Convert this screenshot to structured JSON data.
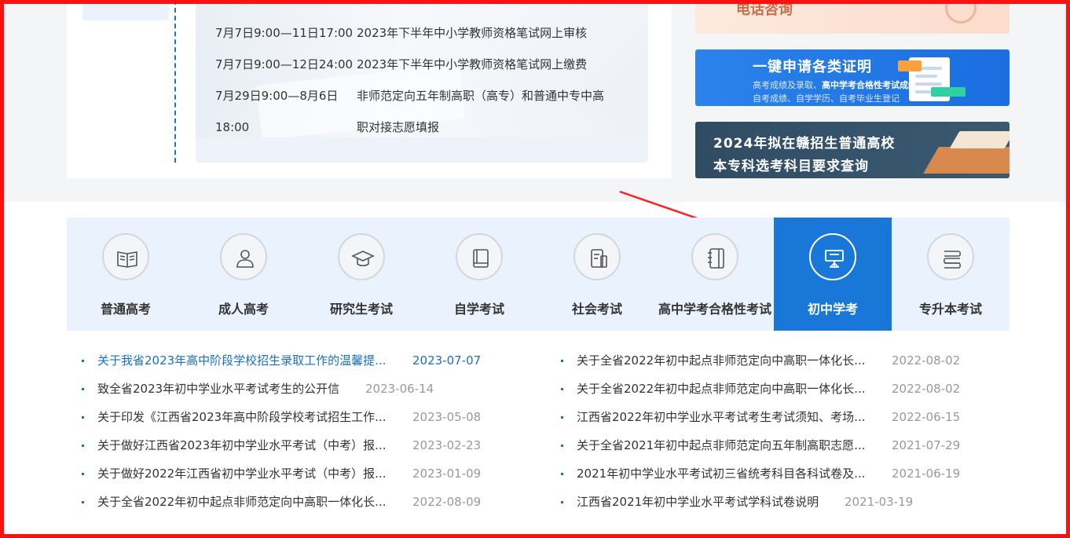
{
  "schedule": [
    {
      "date": "7月7日9:00—11日17:00",
      "text": "2023年下半年中小学教师资格笔试网上审核"
    },
    {
      "date": "7月7日9:00—12日24:00",
      "text": "2023年下半年中小学教师资格笔试网上缴费"
    },
    {
      "date": "7月29日9:00—8月6日",
      "text": "非师范定向五年制高职（高专）和普通中专中高"
    },
    {
      "date": "18:00",
      "text": "职对接志愿填报"
    }
  ],
  "banners": {
    "phone": {
      "title": "电话咨询"
    },
    "cert": {
      "title": "一键申请各类证明",
      "sub1_prefix": "高考成绩及录取、",
      "sub1_bold": "高中学考合格性考试成绩",
      "sub2": "自考成绩、自学学历、自考毕业生登记"
    },
    "major": {
      "line1": "2024年拟在赣招生普通高校",
      "line2": "本专科选考科目要求查询"
    }
  },
  "tabs": [
    {
      "label": "普通高考",
      "icon": "book-icon",
      "active": false
    },
    {
      "label": "成人高考",
      "icon": "person-icon",
      "active": false
    },
    {
      "label": "研究生考试",
      "icon": "graduation-cap-icon",
      "active": false
    },
    {
      "label": "自学考试",
      "icon": "textbook-icon",
      "active": false
    },
    {
      "label": "社会考试",
      "icon": "document-icon",
      "active": false
    },
    {
      "label": "高中学考合格性考试",
      "icon": "notebook-icon",
      "active": false
    },
    {
      "label": "初中学考",
      "icon": "presentation-board-icon",
      "active": true
    },
    {
      "label": "专升本考试",
      "icon": "stacked-books-icon",
      "active": false
    }
  ],
  "news_left": [
    {
      "title": "关于我省2023年高中阶段学校招生录取工作的温馨提...",
      "date": "2023-07-07",
      "highlight": true
    },
    {
      "title": "致全省2023年初中学业水平考试考生的公开信",
      "date": "2023-06-14",
      "highlight": false
    },
    {
      "title": "关于印发《江西省2023年高中阶段学校考试招生工作...",
      "date": "2023-05-08",
      "highlight": false
    },
    {
      "title": "关于做好江西省2023年初中学业水平考试（中考）报...",
      "date": "2023-02-23",
      "highlight": false
    },
    {
      "title": "关于做好2022年江西省初中学业水平考试（中考）报...",
      "date": "2023-01-09",
      "highlight": false
    },
    {
      "title": "关于全省2022年初中起点非师范定向中高职一体化长...",
      "date": "2022-08-09",
      "highlight": false
    }
  ],
  "news_right": [
    {
      "title": "关于全省2022年初中起点非师范定向中高职一体化长...",
      "date": "2022-08-02",
      "highlight": false
    },
    {
      "title": "关于全省2022年初中起点非师范定向中高职一体化长...",
      "date": "2022-08-02",
      "highlight": false
    },
    {
      "title": "江西省2022年初中学业水平考试考生考试须知、考场...",
      "date": "2022-06-15",
      "highlight": false
    },
    {
      "title": "关于全省2021年初中起点非师范定向五年制高职志愿...",
      "date": "2021-07-29",
      "highlight": false
    },
    {
      "title": "2021年初中学业水平考试初三省统考科目各科试卷及...",
      "date": "2021-06-19",
      "highlight": false
    },
    {
      "title": "江西省2021年初中学业水平考试学科试卷说明",
      "date": "2021-03-19",
      "highlight": false
    }
  ],
  "colors": {
    "accent": "#1877d7",
    "frame": "#ff1010",
    "link": "#1a6ec8"
  }
}
